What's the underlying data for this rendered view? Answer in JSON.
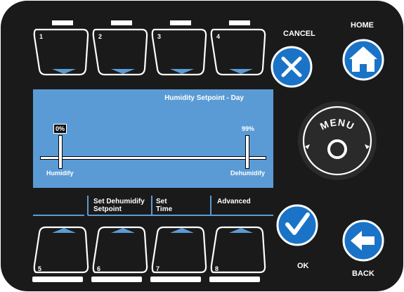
{
  "device": {
    "body_color": "#1a1a1a",
    "screen_color": "#5b9bd5",
    "accent_color": "#1a73c7"
  },
  "top_keys": [
    {
      "number": "1"
    },
    {
      "number": "2"
    },
    {
      "number": "3"
    },
    {
      "number": "4"
    }
  ],
  "bottom_keys": [
    {
      "number": "5"
    },
    {
      "number": "6"
    },
    {
      "number": "7"
    },
    {
      "number": "8"
    }
  ],
  "buttons": {
    "cancel_label": "CANCEL",
    "cancel_icon": "x-icon",
    "home_label": "HOME",
    "home_icon": "house-icon",
    "menu_label": "MENU",
    "ok_label": "OK",
    "ok_icon": "checkmark-icon",
    "back_label": "BACK",
    "back_icon": "left-arrow-icon"
  },
  "screen": {
    "title": "Humidity Setpoint - Day",
    "left_value": "0%",
    "right_value": "99%",
    "left_label": "Humidify",
    "right_label": "Dehumidify",
    "softkeys": [
      {
        "line1": "",
        "line2": ""
      },
      {
        "line1": "Set Dehumidify",
        "line2": "Setpoint"
      },
      {
        "line1": "Set",
        "line2": "Time"
      },
      {
        "line1": "Advanced",
        "line2": ""
      }
    ]
  }
}
